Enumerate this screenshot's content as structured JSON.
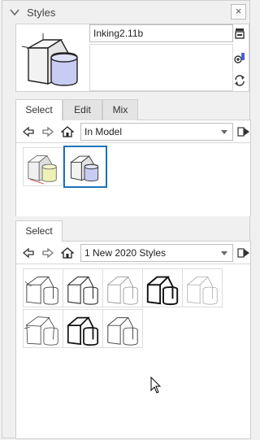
{
  "header": {
    "title": "Styles",
    "close_label": "×"
  },
  "style": {
    "name": "Inking2.11b",
    "description": ""
  },
  "tabs_top": [
    {
      "label": "Select",
      "active": true
    },
    {
      "label": "Edit",
      "active": false
    },
    {
      "label": "Mix",
      "active": false
    }
  ],
  "collection_top": {
    "selected": "In Model"
  },
  "in_model_thumbs": [
    {
      "name": "default-style-thumb",
      "selected": false
    },
    {
      "name": "inking-style-thumb",
      "selected": true
    }
  ],
  "tabs_bottom": [
    {
      "label": "Select",
      "active": true
    }
  ],
  "collection_bottom": {
    "selected": "1 New 2020 Styles"
  },
  "bottom_thumbs_count": 8,
  "colors": {
    "accent": "#1a73b8",
    "cube_face": "#f4f4f4",
    "cylinder_blue": "#c8ccf2",
    "cylinder_yellow": "#eef0b5"
  },
  "icons": {
    "collapse": "chevron-down-icon",
    "close": "close-icon",
    "update": "update-style-icon",
    "create": "create-style-icon",
    "refresh": "refresh-icon",
    "back": "back-arrow-icon",
    "forward": "forward-arrow-icon",
    "home": "home-icon",
    "details": "details-arrow-icon"
  }
}
